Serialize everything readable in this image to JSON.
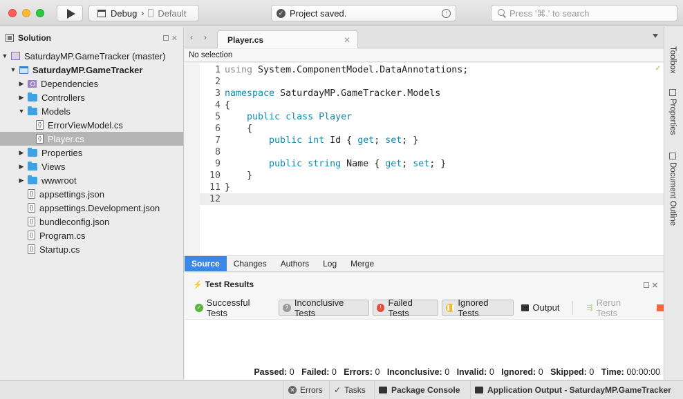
{
  "toolbar": {
    "configuration": "Debug",
    "separator": "›",
    "device": "Default",
    "status": "Project saved.",
    "search_placeholder": "Press '⌘.' to search"
  },
  "solution_pad": {
    "title": "Solution",
    "items": [
      {
        "label": "SaturdayMP.GameTracker (master)",
        "level": 0,
        "expanded": true,
        "icon": "solution-icon",
        "bold": false
      },
      {
        "label": "SaturdayMP.GameTracker",
        "level": 1,
        "expanded": true,
        "icon": "project-icon",
        "bold": true
      },
      {
        "label": "Dependencies",
        "level": 2,
        "expanded": false,
        "icon": "dependencies-icon",
        "bold": false
      },
      {
        "label": "Controllers",
        "level": 2,
        "expanded": false,
        "icon": "folder-icon",
        "bold": false
      },
      {
        "label": "Models",
        "level": 2,
        "expanded": true,
        "icon": "folder-icon",
        "bold": false
      },
      {
        "label": "ErrorViewModel.cs",
        "level": 3,
        "expanded": null,
        "icon": "cs-file-icon",
        "bold": false
      },
      {
        "label": "Player.cs",
        "level": 3,
        "expanded": null,
        "icon": "cs-file-icon",
        "bold": false,
        "selected": true
      },
      {
        "label": "Properties",
        "level": 2,
        "expanded": false,
        "icon": "folder-icon",
        "bold": false
      },
      {
        "label": "Views",
        "level": 2,
        "expanded": false,
        "icon": "folder-icon",
        "bold": false
      },
      {
        "label": "wwwroot",
        "level": 2,
        "expanded": false,
        "icon": "folder-icon",
        "bold": false
      },
      {
        "label": "appsettings.json",
        "level": 2,
        "expanded": null,
        "icon": "json-file-icon",
        "bold": false
      },
      {
        "label": "appsettings.Development.json",
        "level": 2,
        "expanded": null,
        "icon": "json-file-icon",
        "bold": false
      },
      {
        "label": "bundleconfig.json",
        "level": 2,
        "expanded": null,
        "icon": "json-file-icon",
        "bold": false
      },
      {
        "label": "Program.cs",
        "level": 2,
        "expanded": null,
        "icon": "cs-file-icon",
        "bold": false
      },
      {
        "label": "Startup.cs",
        "level": 2,
        "expanded": null,
        "icon": "cs-file-icon",
        "bold": false
      }
    ]
  },
  "editor": {
    "tab_label": "Player.cs",
    "breadcrumb": "No selection",
    "current_line": 12,
    "lines": [
      {
        "n": "1",
        "tokens": [
          {
            "t": "using",
            "c": "kw-using"
          },
          {
            "t": " System.ComponentModel.DataAnnotations;",
            "c": ""
          }
        ]
      },
      {
        "n": "2",
        "tokens": []
      },
      {
        "n": "3",
        "tokens": [
          {
            "t": "namespace",
            "c": "kw"
          },
          {
            "t": " SaturdayMP.GameTracker.Models",
            "c": ""
          }
        ]
      },
      {
        "n": "4",
        "tokens": [
          {
            "t": "{",
            "c": ""
          }
        ]
      },
      {
        "n": "5",
        "tokens": [
          {
            "t": "    ",
            "c": ""
          },
          {
            "t": "public",
            "c": "kw"
          },
          {
            "t": " ",
            "c": ""
          },
          {
            "t": "class",
            "c": "kw"
          },
          {
            "t": " ",
            "c": ""
          },
          {
            "t": "Player",
            "c": "type"
          }
        ]
      },
      {
        "n": "6",
        "tokens": [
          {
            "t": "    {",
            "c": ""
          }
        ]
      },
      {
        "n": "7",
        "tokens": [
          {
            "t": "        ",
            "c": ""
          },
          {
            "t": "public",
            "c": "kw"
          },
          {
            "t": " ",
            "c": ""
          },
          {
            "t": "int",
            "c": "kw"
          },
          {
            "t": " Id { ",
            "c": ""
          },
          {
            "t": "get",
            "c": "kw"
          },
          {
            "t": "; ",
            "c": ""
          },
          {
            "t": "set",
            "c": "kw"
          },
          {
            "t": "; }",
            "c": ""
          }
        ]
      },
      {
        "n": "8",
        "tokens": []
      },
      {
        "n": "9",
        "tokens": [
          {
            "t": "        ",
            "c": ""
          },
          {
            "t": "public",
            "c": "kw"
          },
          {
            "t": " ",
            "c": ""
          },
          {
            "t": "string",
            "c": "kw"
          },
          {
            "t": " Name { ",
            "c": ""
          },
          {
            "t": "get",
            "c": "kw"
          },
          {
            "t": "; ",
            "c": ""
          },
          {
            "t": "set",
            "c": "kw"
          },
          {
            "t": "; }",
            "c": ""
          }
        ]
      },
      {
        "n": "10",
        "tokens": [
          {
            "t": "    }",
            "c": ""
          }
        ]
      },
      {
        "n": "11",
        "tokens": [
          {
            "t": "}",
            "c": ""
          }
        ]
      },
      {
        "n": "12",
        "tokens": []
      }
    ],
    "source_tabs": [
      "Source",
      "Changes",
      "Authors",
      "Log",
      "Merge"
    ],
    "active_source_tab": "Source"
  },
  "right_dock": {
    "toolbox": "Toolbox",
    "properties": "Properties",
    "document_outline": "Document Outline"
  },
  "test_results": {
    "title": "Test Results",
    "buttons": {
      "successful": "Successful Tests",
      "inconclusive": "Inconclusive Tests",
      "failed": "Failed Tests",
      "ignored": "Ignored Tests",
      "output": "Output",
      "rerun": "Rerun Tests"
    },
    "summary": {
      "passed_label": "Passed:",
      "passed": "0",
      "failed_label": "Failed:",
      "failed": "0",
      "errors_label": "Errors:",
      "errors": "0",
      "inconclusive_label": "Inconclusive:",
      "inconclusive": "0",
      "invalid_label": "Invalid:",
      "invalid": "0",
      "ignored_label": "Ignored:",
      "ignored": "0",
      "skipped_label": "Skipped:",
      "skipped": "0",
      "time_label": "Time:",
      "time": "00:00:00"
    }
  },
  "status_bar": {
    "errors": "Errors",
    "tasks": "Tasks",
    "package_console": "Package Console",
    "app_output": "Application Output - SaturdayMP.GameTracker"
  },
  "colors": {
    "accent": "#3b88e6",
    "keyword": "#0f8ab0",
    "folder": "#3ea3e2"
  }
}
